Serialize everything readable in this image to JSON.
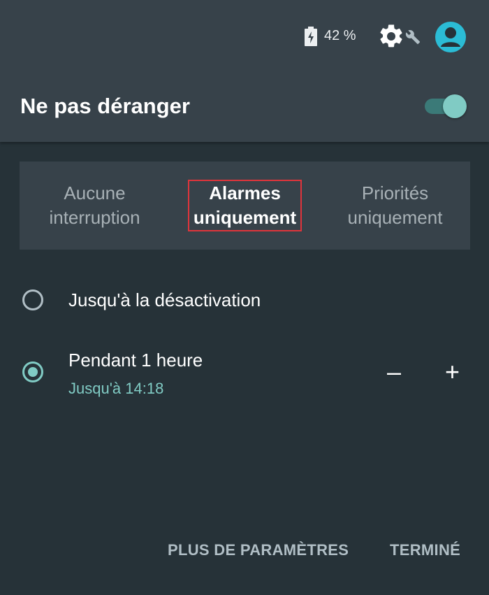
{
  "status": {
    "battery_percent": "42 %"
  },
  "panel": {
    "title": "Ne pas déranger",
    "toggle_on": true
  },
  "modes": [
    {
      "label_line1": "Aucune",
      "label_line2": "interruption",
      "selected": false
    },
    {
      "label_line1": "Alarmes",
      "label_line2": "uniquement",
      "selected": true
    },
    {
      "label_line1": "Priorités",
      "label_line2": "uniquement",
      "selected": false
    }
  ],
  "options": [
    {
      "label": "Jusqu'à la désactivation",
      "checked": false
    },
    {
      "label": "Pendant 1 heure",
      "sublabel": "Jusqu'à 14:18",
      "checked": true
    }
  ],
  "stepper": {
    "decrease": "–",
    "increase": "+"
  },
  "actions": {
    "more_settings": "PLUS DE PARAMÈTRES",
    "done": "TERMINÉ"
  },
  "colors": {
    "background": "#263238",
    "header": "#37424a",
    "accent": "#80cbc4",
    "avatar": "#2bbcd5",
    "highlight_border": "#e0343b"
  },
  "icons": [
    "battery-icon",
    "settings-gear-icon",
    "wrench-icon",
    "account-icon"
  ]
}
